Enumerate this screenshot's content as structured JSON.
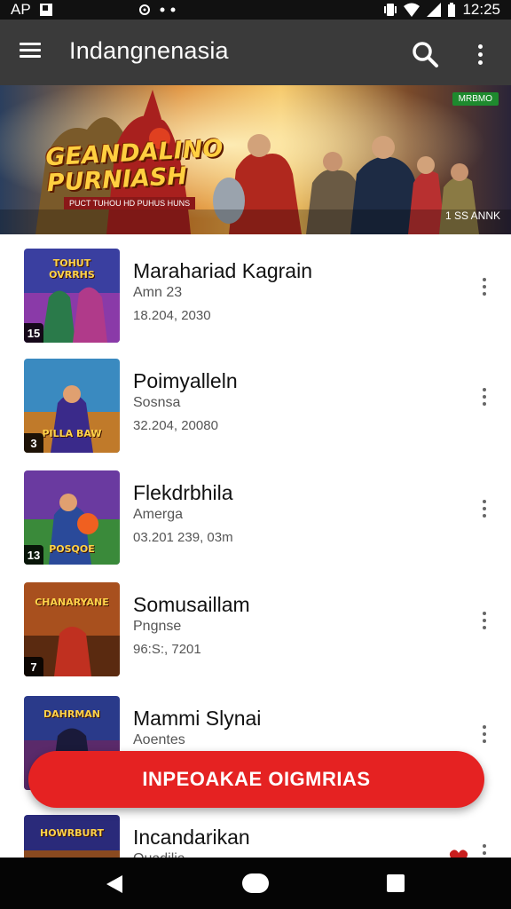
{
  "status_bar": {
    "carrier": "AP",
    "time": "12:25",
    "icons": [
      "sim-icon",
      "sync-icon",
      "notification-dots-icon",
      "vibrate-icon",
      "wifi-icon",
      "signal-icon",
      "battery-icon"
    ]
  },
  "app_bar": {
    "title": "Indangnenasia",
    "icons": [
      "menu-icon",
      "search-icon",
      "more-vert-icon"
    ]
  },
  "banner": {
    "title_line1": "GEANDALINO",
    "title_line2": "PURNIASH",
    "subtitle": "PUCT TUHOU HD PUHUS HUNS",
    "badge": "MRBMO",
    "caption": "1 SS ANNK"
  },
  "list": {
    "items": [
      {
        "title": "Marahariad Kagrain",
        "subtitle": "Amn 23",
        "meta": "18.204, 2030",
        "thumb_label": "TOHUT OVRRHS",
        "thumb_badge": "15"
      },
      {
        "title": "Poimyalleln",
        "subtitle": "Sosnsa",
        "meta": "32.204, 20080",
        "thumb_label": "PILLA BAW",
        "thumb_badge": "3"
      },
      {
        "title": "Flekdrbhila",
        "subtitle": "Amerga",
        "meta": "03.201 239, 03m",
        "thumb_label": "POSQOE",
        "thumb_badge": "13"
      },
      {
        "title": "Somusaillam",
        "subtitle": "Pngnse",
        "meta": "96:S:, 7201",
        "thumb_label": "CHANARYANE",
        "thumb_badge": "7"
      },
      {
        "title": "Mammi Slynai",
        "subtitle": "Aoentes",
        "meta": "",
        "thumb_label": "DAHRMAN",
        "thumb_badge": ""
      },
      {
        "title": "Incandarikan",
        "subtitle": "Ouadilia",
        "meta": "",
        "thumb_label": "HOWRBURT",
        "thumb_badge": ""
      }
    ]
  },
  "cta": {
    "label": "INPEOAKAE OIGMRIAS",
    "color": "#e52222"
  },
  "nav_bar": {
    "icons": [
      "back-icon",
      "home-icon",
      "recents-icon"
    ]
  },
  "colors": {
    "app_bar": "#3a3a3a",
    "status_bar": "#111111",
    "accent": "#e52222"
  }
}
